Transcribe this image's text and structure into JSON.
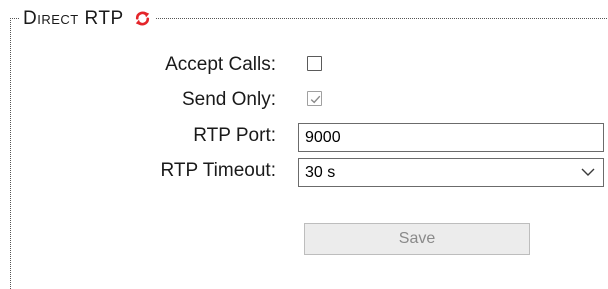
{
  "section": {
    "title": "Direct RTP",
    "refresh_icon": "refresh-icon",
    "refresh_color": "#e4252a"
  },
  "fields": {
    "accept_calls": {
      "label": "Accept Calls:",
      "checked": false
    },
    "send_only": {
      "label": "Send Only:",
      "checked": true,
      "disabled": true
    },
    "rtp_port": {
      "label": "RTP Port:",
      "value": "9000"
    },
    "rtp_timeout": {
      "label": "RTP Timeout:",
      "value": "30 s",
      "icon": "chevron-down-icon"
    }
  },
  "actions": {
    "save_label": "Save",
    "save_disabled": true
  }
}
